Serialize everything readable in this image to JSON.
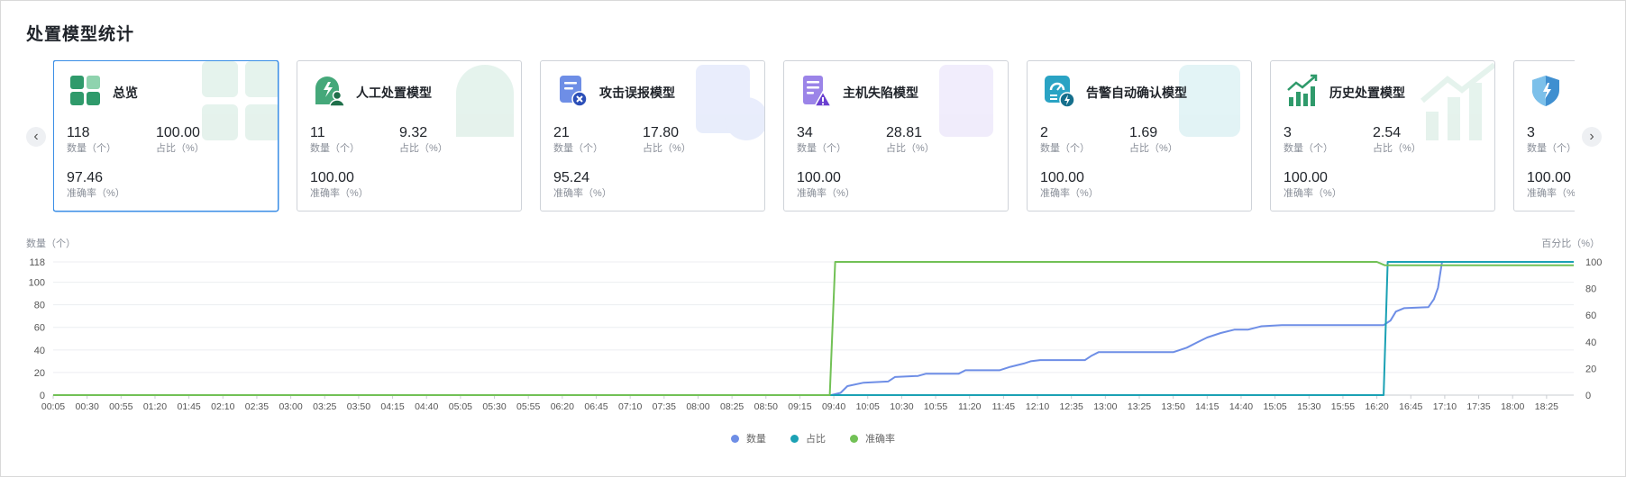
{
  "title": "处置模型统计",
  "nav": {
    "prev": "‹",
    "next": "›"
  },
  "cards": [
    {
      "name": "总览",
      "icon": "grid-icon",
      "active": true,
      "count": "118",
      "count_label": "数量（个）",
      "ratio": "100.00",
      "ratio_label": "占比（%）",
      "accuracy": "97.46",
      "accuracy_label": "准确率（%）"
    },
    {
      "name": "人工处置模型",
      "icon": "manual-user-icon",
      "count": "11",
      "count_label": "数量（个）",
      "ratio": "9.32",
      "ratio_label": "占比（%）",
      "accuracy": "100.00",
      "accuracy_label": "准确率（%）"
    },
    {
      "name": "攻击误报模型",
      "icon": "false-alarm-icon",
      "count": "21",
      "count_label": "数量（个）",
      "ratio": "17.80",
      "ratio_label": "占比（%）",
      "accuracy": "95.24",
      "accuracy_label": "准确率（%）"
    },
    {
      "name": "主机失陷模型",
      "icon": "host-warning-icon",
      "count": "34",
      "count_label": "数量（个）",
      "ratio": "28.81",
      "ratio_label": "占比（%）",
      "accuracy": "100.00",
      "accuracy_label": "准确率（%）"
    },
    {
      "name": "告警自动确认模型",
      "icon": "auto-confirm-icon",
      "count": "2",
      "count_label": "数量（个）",
      "ratio": "1.69",
      "ratio_label": "占比（%）",
      "accuracy": "100.00",
      "accuracy_label": "准确率（%）"
    },
    {
      "name": "历史处置模型",
      "icon": "history-chart-icon",
      "count": "3",
      "count_label": "数量（个）",
      "ratio": "2.54",
      "ratio_label": "占比（%）",
      "accuracy": "100.00",
      "accuracy_label": "准确率（%）"
    },
    {
      "name": "",
      "icon": "shield-icon",
      "count": "3",
      "count_label": "数量（个）",
      "ratio": "",
      "ratio_label": "",
      "accuracy": "100.00",
      "accuracy_label": "准确率（%）"
    }
  ],
  "colors": {
    "count": "#6e8ee6",
    "ratio": "#1ba1b4",
    "accuracy": "#72c156",
    "active_border": "#3a8ee6"
  },
  "chart_data": {
    "type": "line",
    "ylabel_left": "数量（个）",
    "ylabel_right": "百分比（%）",
    "y_left_ticks": [
      0,
      20,
      40,
      60,
      80,
      100,
      118
    ],
    "y_left_max": 118,
    "y_right_ticks": [
      0,
      20,
      40,
      60,
      80,
      100
    ],
    "y_right_max": 100,
    "x_ticks": [
      "00:05",
      "00:30",
      "00:55",
      "01:20",
      "01:45",
      "02:10",
      "02:35",
      "03:00",
      "03:25",
      "03:50",
      "04:15",
      "04:40",
      "05:05",
      "05:30",
      "05:55",
      "06:20",
      "06:45",
      "07:10",
      "07:35",
      "08:00",
      "08:25",
      "08:50",
      "09:15",
      "09:40",
      "10:05",
      "10:30",
      "10:55",
      "11:20",
      "11:45",
      "12:10",
      "12:35",
      "13:00",
      "13:25",
      "13:50",
      "14:15",
      "14:40",
      "15:05",
      "15:30",
      "15:55",
      "16:20",
      "16:45",
      "17:10",
      "17:35",
      "18:00",
      "18:25"
    ],
    "x_range": [
      "00:05",
      "18:45"
    ],
    "grid": true,
    "legend_position": "bottom",
    "series": [
      {
        "name": "数量",
        "axis": "left",
        "color": "#6e8ee6",
        "points": [
          [
            "00:05",
            0
          ],
          [
            "09:38",
            0
          ],
          [
            "09:45",
            2
          ],
          [
            "09:50",
            8
          ],
          [
            "10:02",
            11
          ],
          [
            "10:20",
            12
          ],
          [
            "10:25",
            16
          ],
          [
            "10:42",
            17
          ],
          [
            "10:48",
            19
          ],
          [
            "11:12",
            19
          ],
          [
            "11:17",
            22
          ],
          [
            "11:42",
            22
          ],
          [
            "11:50",
            25
          ],
          [
            "12:00",
            28
          ],
          [
            "12:05",
            30
          ],
          [
            "12:12",
            31
          ],
          [
            "12:45",
            31
          ],
          [
            "12:50",
            35
          ],
          [
            "12:55",
            38
          ],
          [
            "13:50",
            38
          ],
          [
            "14:00",
            42
          ],
          [
            "14:08",
            47
          ],
          [
            "14:15",
            51
          ],
          [
            "14:25",
            55
          ],
          [
            "14:35",
            58
          ],
          [
            "14:45",
            58
          ],
          [
            "14:55",
            61
          ],
          [
            "15:10",
            62
          ],
          [
            "16:25",
            62
          ],
          [
            "16:30",
            66
          ],
          [
            "16:34",
            74
          ],
          [
            "16:40",
            77
          ],
          [
            "16:58",
            78
          ],
          [
            "17:02",
            85
          ],
          [
            "17:05",
            95
          ],
          [
            "17:08",
            118
          ],
          [
            "18:45",
            118
          ]
        ]
      },
      {
        "name": "占比",
        "axis": "right",
        "color": "#1ba1b4",
        "points": [
          [
            "00:05",
            0
          ],
          [
            "16:25",
            0
          ],
          [
            "16:28",
            100
          ],
          [
            "18:45",
            100
          ]
        ]
      },
      {
        "name": "准确率",
        "axis": "right",
        "color": "#72c156",
        "points": [
          [
            "00:05",
            0
          ],
          [
            "09:37",
            0
          ],
          [
            "09:39",
            50
          ],
          [
            "09:41",
            100
          ],
          [
            "16:20",
            100
          ],
          [
            "16:26",
            97.46
          ],
          [
            "18:45",
            97.46
          ]
        ]
      }
    ]
  }
}
